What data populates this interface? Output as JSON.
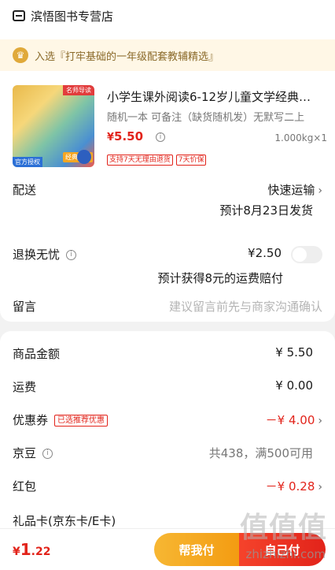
{
  "store": {
    "name": "滨悟图书专营店",
    "icon": "store-icon"
  },
  "badge": {
    "icon": "trophy-icon",
    "text": "入选『打牢基础的一年级配套教辅精选』"
  },
  "product": {
    "title": "小学生课外阅读6-12岁儿童文学经典…",
    "spec": "随机一本 可备注（缺货随机发）无默写二上",
    "price_symbol": "¥",
    "price": "5.50",
    "weight_qty": "1.000kg×1",
    "tags": [
      "支持7天无理由退货",
      "7天价保"
    ],
    "thumb_tags": [
      "名师导读",
      "经典名著",
      "官方授权"
    ]
  },
  "delivery": {
    "label": "配送",
    "method": "快速运输",
    "eta": "预计8月23日发货"
  },
  "return_service": {
    "label": "退换无忧",
    "price": "¥2.50",
    "note": "预计获得8元的运费赔付"
  },
  "message": {
    "label": "留言",
    "placeholder": "建议留言前先与商家沟通确认"
  },
  "summary": {
    "goods_amount_label": "商品金额",
    "goods_amount": "¥ 5.50",
    "shipping_label": "运费",
    "shipping": "¥ 0.00",
    "coupon_label": "优惠券",
    "coupon_tag": "已选推荐优惠",
    "coupon_value": "－¥ 4.00",
    "jd_bean_label": "京豆",
    "jd_bean_value": "共438，满500可用",
    "red_packet_label": "红包",
    "red_packet_value": "－¥ 0.28",
    "gift_card_label": "礼品卡(京东卡/E卡)"
  },
  "footer": {
    "total_symbol": "¥",
    "total_int": "1",
    "total_dec": ".22",
    "help_pay_label": "帮我付",
    "self_pay_label": "自己付"
  },
  "watermark": {
    "text": "值值值",
    "url": "zhizhizhi.com"
  },
  "colors": {
    "accent": "#e2231a",
    "gold": "#f39c12"
  }
}
